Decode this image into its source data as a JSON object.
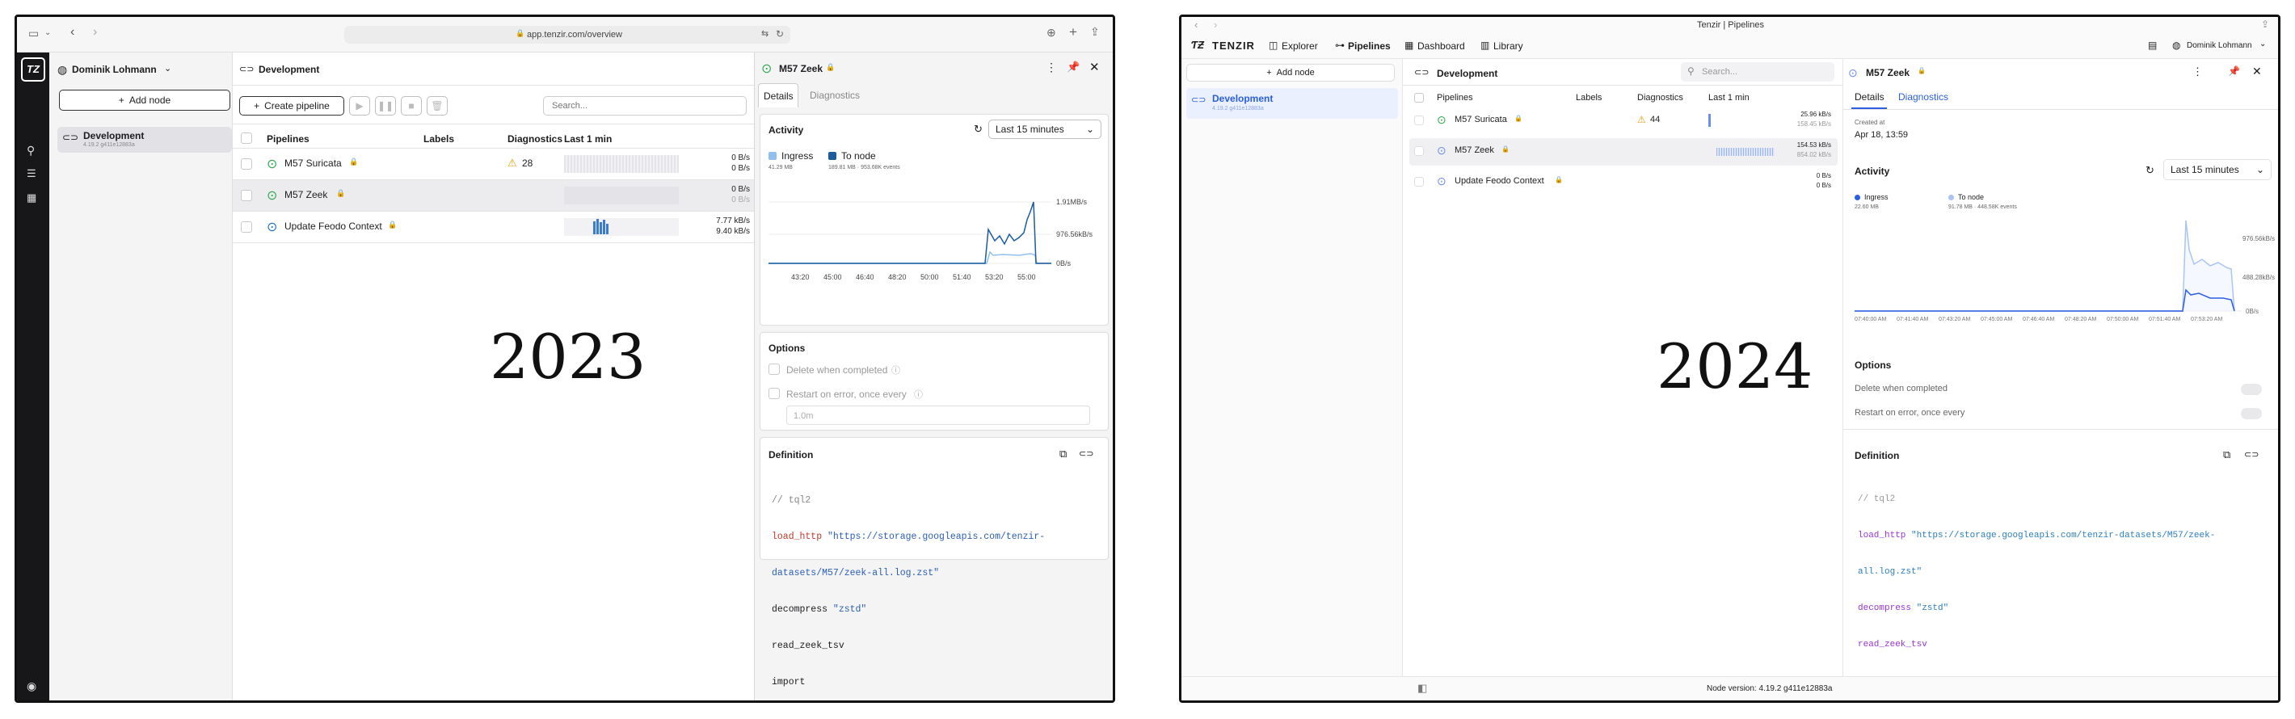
{
  "y2023": {
    "browser": {
      "url": "app.tenzir.com/overview"
    },
    "sidebar": {
      "brand": "TENZIR"
    },
    "nodes": {
      "user": "Dominik Lohmann",
      "add_node": "Add node",
      "node_name": "Development",
      "node_version": "4.19.2 g411e12883a"
    },
    "pipelines": {
      "title": "Development",
      "create": "Create pipeline",
      "search_placeholder": "Search...",
      "columns": {
        "pipelines": "Pipelines",
        "labels": "Labels",
        "diagnostics": "Diagnostics",
        "last": "Last 1 min"
      },
      "rows": [
        {
          "name": "M57 Suricata",
          "diag": "28",
          "in": "0 B/s",
          "out": "0 B/s"
        },
        {
          "name": "M57 Zeek",
          "diag": "",
          "in": "0 B/s",
          "out": "0 B/s"
        },
        {
          "name": "Update Feodo Context",
          "diag": "",
          "in": "7.77 kB/s",
          "out": "9.40 kB/s"
        }
      ]
    },
    "detail": {
      "title": "M57 Zeek",
      "tabs": {
        "details": "Details",
        "diagnostics": "Diagnostics"
      },
      "activity": {
        "title": "Activity",
        "range": "Last 15 minutes",
        "ingress": "Ingress",
        "ingress_stat": "41.29 MB",
        "tonode": "To node",
        "tonode_stat": "189.81 MB · 953.68K events",
        "yticks": [
          "1.91MB/s",
          "976.56kB/s",
          "0B/s"
        ],
        "xticks": [
          "43:20",
          "45:00",
          "46:40",
          "48:20",
          "50:00",
          "51:40",
          "53:20",
          "55:00"
        ]
      },
      "options": {
        "title": "Options",
        "delete": "Delete when completed",
        "restart": "Restart on error, once every",
        "restart_value": "1.0m"
      },
      "definition": {
        "title": "Definition",
        "comment": "// tql2",
        "l1_fn": "load_http",
        "l1_str": "\"https://storage.googleapis.com/tenzir-",
        "l2_str": "datasets/M57/zeek-all.log.zst\"",
        "l3_fn": "decompress",
        "l3_str": "\"zstd\"",
        "l4": "read_zeek_tsv",
        "l5": "import"
      }
    },
    "year": "2023"
  },
  "y2024": {
    "window_title": "Tenzir | Pipelines",
    "nav": {
      "brand": "TENZIR",
      "explorer": "Explorer",
      "pipelines": "Pipelines",
      "dashboard": "Dashboard",
      "library": "Library",
      "user": "Dominik Lohmann"
    },
    "nodes": {
      "add_node": "Add node",
      "node_name": "Development",
      "node_version": "4.19.2 g411e12883a"
    },
    "pipelines": {
      "title": "Development",
      "search_placeholder": "Search...",
      "columns": {
        "pipelines": "Pipelines",
        "labels": "Labels",
        "diagnostics": "Diagnostics",
        "last": "Last 1 min"
      },
      "rows": [
        {
          "name": "M57 Suricata",
          "diag": "44",
          "in": "25.96 kB/s",
          "out": "158.45 kB/s"
        },
        {
          "name": "M57 Zeek",
          "diag": "",
          "in": "154.53 kB/s",
          "out": "854.02 kB/s"
        },
        {
          "name": "Update Feodo Context",
          "diag": "",
          "in": "0 B/s",
          "out": "0 B/s"
        }
      ]
    },
    "detail": {
      "title": "M57 Zeek",
      "tabs": {
        "details": "Details",
        "diagnostics": "Diagnostics"
      },
      "created_label": "Created at",
      "created_value": "Apr 18, 13:59",
      "activity": {
        "title": "Activity",
        "range": "Last 15 minutes",
        "ingress": "Ingress",
        "ingress_stat": "22.60 MB",
        "tonode": "To node",
        "tonode_stat": "91.78 MB · 448.58K events",
        "yticks": [
          "976.56kB/s",
          "488.28kB/s",
          "0B/s"
        ],
        "xticks": [
          "07:40:00 AM",
          "07:41:40 AM",
          "07:43:20 AM",
          "07:45:00 AM",
          "07:46:40 AM",
          "07:48:20 AM",
          "07:50:00 AM",
          "07:51:40 AM",
          "07:53:20 AM"
        ]
      },
      "options": {
        "title": "Options",
        "delete": "Delete when completed",
        "restart": "Restart on error, once every"
      },
      "definition": {
        "title": "Definition",
        "comment": "// tql2",
        "l1_fn": "load_http",
        "l1_str": "\"https://storage.googleapis.com/tenzir-datasets/M57/zeek-",
        "l2_str": "all.log.zst\"",
        "l3_fn": "decompress",
        "l3_str": "\"zstd\"",
        "l4": "read_zeek_tsv",
        "l5": "import"
      }
    },
    "footer": {
      "version": "Node version: 4.19.2 g411e12883a"
    },
    "year": "2024"
  },
  "colors": {
    "accent2023": "#1e6fd9",
    "accent2024": "#2b5fe0",
    "ok": "#2fa84f",
    "warn": "#e69b00",
    "purple": "#9b35d6"
  }
}
